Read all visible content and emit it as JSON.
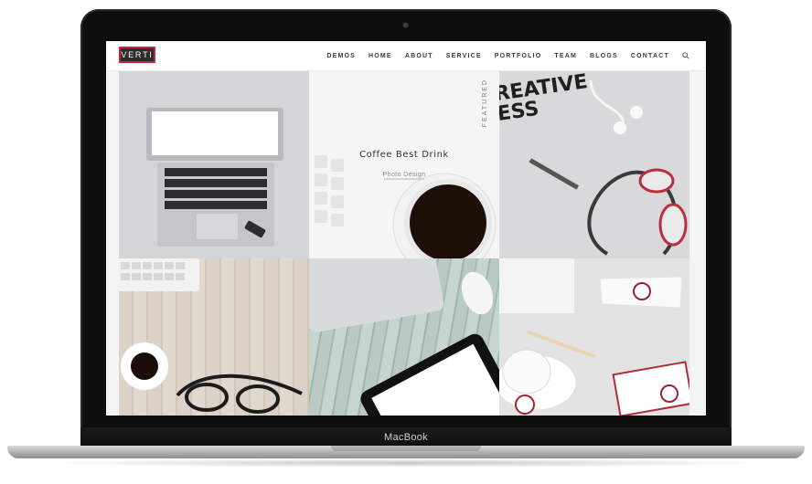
{
  "device": {
    "label": "MacBook"
  },
  "site": {
    "logo": "VERTI",
    "nav": [
      "DEMOS",
      "HOME",
      "ABOUT",
      "SERVICE",
      "PORTFOLIO",
      "TEAM",
      "BLOGS",
      "CONTACT"
    ],
    "search_icon": "search-icon"
  },
  "portfolio": {
    "featured": {
      "badge": "FEATURED",
      "title": "Coffee Best Drink",
      "category": "Photo Design"
    },
    "creative_text": "REATIVE\nESS"
  },
  "colors": {
    "accent": "#c3283a",
    "logo_bg": "#2d2d2f"
  }
}
